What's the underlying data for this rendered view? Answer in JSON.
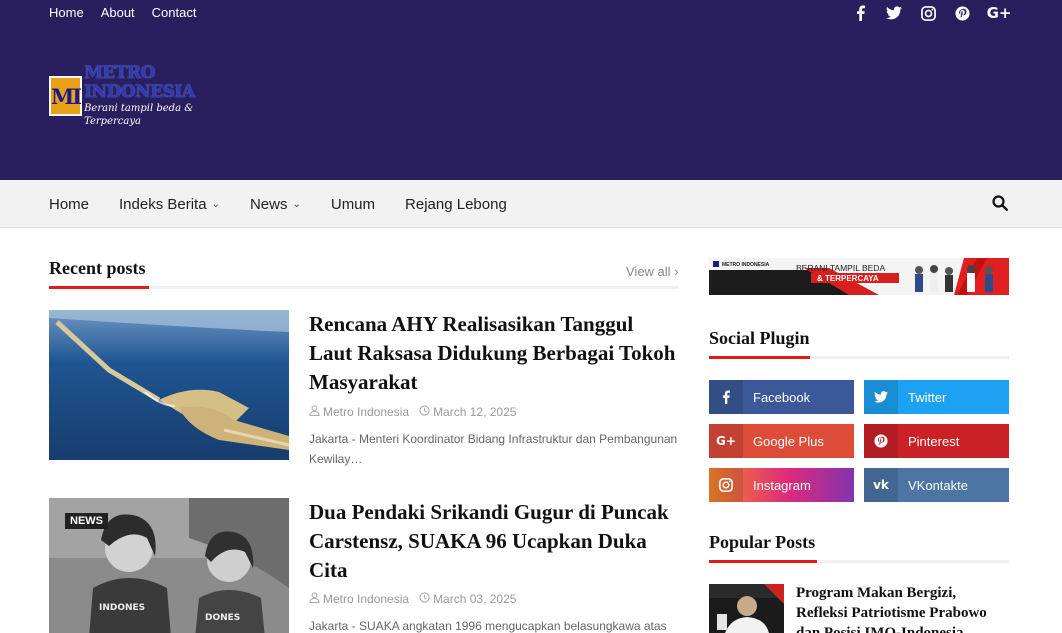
{
  "top_nav": {
    "home": "Home",
    "about": "About",
    "contact": "Contact"
  },
  "top_social": [
    "facebook-icon",
    "twitter-icon",
    "instagram-icon",
    "pinterest-icon",
    "google-plus-icon"
  ],
  "logo": {
    "mark": "MI",
    "title": "METRO INDONESIA",
    "tagline": "Berani tampil beda & Terpercaya"
  },
  "main_nav": {
    "home": "Home",
    "indeks": "Indeks Berita",
    "news": "News",
    "umum": "Umum",
    "rejang": "Rejang Lebong"
  },
  "recent": {
    "heading": "Recent posts",
    "view_all": "View all",
    "posts": [
      {
        "title": "Rencana AHY Realisasikan Tanggul Laut Raksasa Didukung Berbagai Tokoh Masyarakat",
        "author": "Metro Indonesia",
        "date": "March 12, 2025",
        "excerpt": "Jakarta - Menteri Koordinator Bidang Infrastruktur dan Pembangunan Kewilay…"
      },
      {
        "badge": "NEWS",
        "title": "Dua Pendaki Srikandi Gugur di Puncak Carstensz, SUAKA 96 Ucapkan Duka Cita",
        "author": "Metro Indonesia",
        "date": "March 03, 2025",
        "excerpt": "Jakarta - SUAKA angkatan 1996 mengucapkan belasungkawa atas"
      }
    ]
  },
  "banner": {
    "brand": "METRO INDONESIA",
    "line1": "BERANI TAMPIL BEDA",
    "line2": "& TERPERCAYA"
  },
  "social_plugin": {
    "heading": "Social Plugin",
    "buttons": [
      {
        "label": "Facebook",
        "color": "#3b5998"
      },
      {
        "label": "Twitter",
        "color": "#1da1f2"
      },
      {
        "label": "Google Plus",
        "color": "#dd4b39"
      },
      {
        "label": "Pinterest",
        "color": "#ca2127"
      },
      {
        "label": "Instagram",
        "color": "#c13584"
      },
      {
        "label": "VKontakte",
        "color": "#4c75a3"
      }
    ]
  },
  "popular": {
    "heading": "Popular Posts",
    "first_title": "Program Makan Bergizi, Refleksi Patriotisme Prabowo dan Posisi IMO-Indonesia"
  },
  "colors": {
    "header_bg": "#2a1f5e",
    "accent_red": "#e21b1b"
  }
}
